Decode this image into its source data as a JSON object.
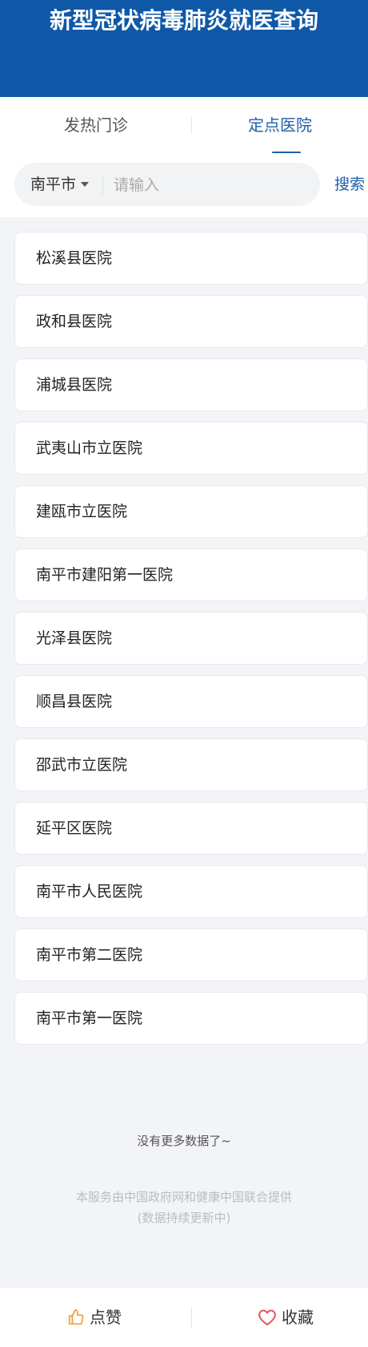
{
  "header": {
    "title": "新型冠状病毒肺炎就医查询"
  },
  "tabs": [
    {
      "label": "发热门诊",
      "active": false
    },
    {
      "label": "定点医院",
      "active": true
    }
  ],
  "search": {
    "city": "南平市",
    "placeholder": "请输入",
    "value": "",
    "button_label": "搜索"
  },
  "hospitals": [
    "松溪县医院",
    "政和县医院",
    "浦城县医院",
    "武夷山市立医院",
    "建瓯市立医院",
    "南平市建阳第一医院",
    "光泽县医院",
    "顺昌县医院",
    "邵武市立医院",
    "延平区医院",
    "南平市人民医院",
    "南平市第二医院",
    "南平市第一医院"
  ],
  "list_end_text": "没有更多数据了~",
  "footer": {
    "line1": "本服务由中国政府网和健康中国联合提供",
    "line2": "(数据持续更新中)"
  },
  "bottom_bar": {
    "like_label": "点赞",
    "favorite_label": "收藏",
    "like_icon": "thumbs-up-icon",
    "favorite_icon": "heart-icon"
  },
  "colors": {
    "header_bg": "#0f58a8",
    "accent": "#1f5ea8",
    "like_icon": "#f0a43a",
    "favorite_icon": "#e8525e"
  }
}
